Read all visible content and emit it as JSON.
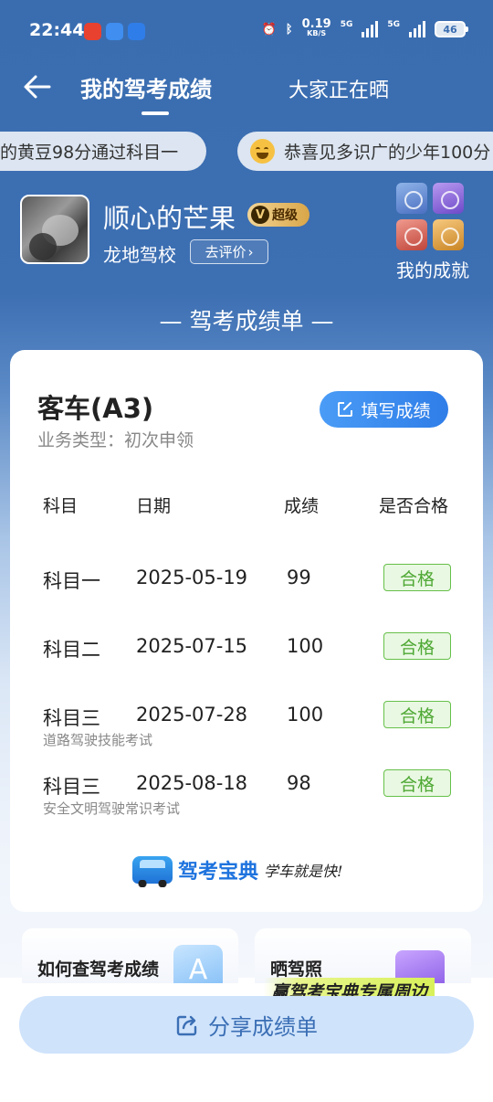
{
  "status_bar": {
    "time": "22:44",
    "net_speed": "0.19",
    "net_unit": "KB/S",
    "sig1": "5G",
    "sig2": "5G",
    "battery": "46"
  },
  "nav": {
    "title": "我的驾考成绩",
    "tab2": "大家正在晒"
  },
  "ticker": {
    "item1": "的黄豆98分通过科目一",
    "item2": "恭喜见多识广的少年100分"
  },
  "profile": {
    "username": "顺心的芒果",
    "vip_v": "V",
    "vip_label": "超级",
    "school": "龙地驾校",
    "rate_button": "去评价",
    "achievements_label": "我的成就"
  },
  "section_title": "— 驾考成绩单 —",
  "card": {
    "vehicle": "客车(A3)",
    "business_type": "业务类型：初次申领",
    "fill_button": "填写成绩",
    "headers": [
      "科目",
      "日期",
      "成绩",
      "是否合格"
    ],
    "rows": [
      {
        "subject": "科目一",
        "date": "2025-05-19",
        "score": "99",
        "result": "合格",
        "note": ""
      },
      {
        "subject": "科目二",
        "date": "2025-07-15",
        "score": "100",
        "result": "合格",
        "note": ""
      },
      {
        "subject": "科目三",
        "date": "2025-07-28",
        "score": "100",
        "result": "合格",
        "note": "道路驾驶技能考试"
      },
      {
        "subject": "科目三",
        "date": "2025-08-18",
        "score": "98",
        "result": "合格",
        "note": "安全文明驾驶常识考试"
      }
    ],
    "brand_name": "驾考宝典",
    "brand_slogan": "学车就是快!"
  },
  "bottom_cards": {
    "card1": "如何查驾考成绩",
    "card2": "晒驾照",
    "promo": "赢驾考宝典专属周边",
    "share_button": "分享成绩单"
  }
}
